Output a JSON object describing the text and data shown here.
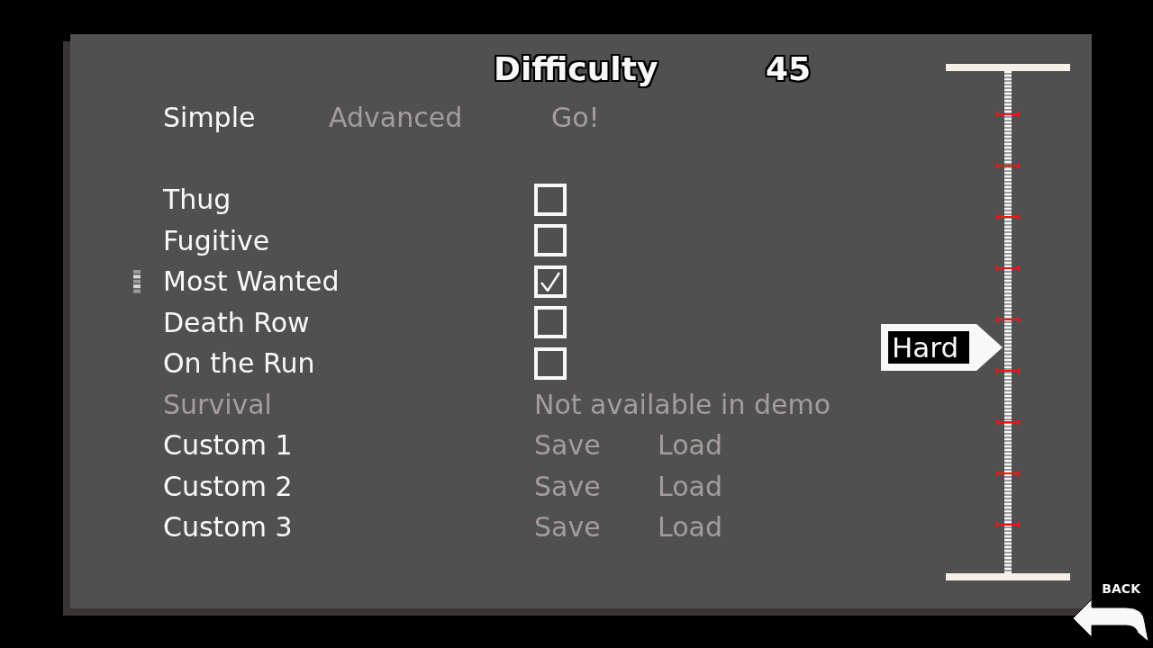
{
  "title": {
    "label": "Difficulty",
    "value": "45"
  },
  "tabs": [
    {
      "label": "Simple",
      "selected": true
    },
    {
      "label": "Advanced",
      "selected": false
    }
  ],
  "go_button": "Go!",
  "rows": [
    {
      "kind": "checkbox",
      "label": "Thug",
      "selected": false,
      "disabled": false,
      "checked": false
    },
    {
      "kind": "checkbox",
      "label": "Fugitive",
      "selected": false,
      "disabled": false,
      "checked": false
    },
    {
      "kind": "checkbox",
      "label": "Most Wanted",
      "selected": true,
      "disabled": false,
      "checked": true
    },
    {
      "kind": "checkbox",
      "label": "Death Row",
      "selected": false,
      "disabled": false,
      "checked": false
    },
    {
      "kind": "checkbox",
      "label": "On the Run",
      "selected": false,
      "disabled": false,
      "checked": false
    },
    {
      "kind": "note",
      "label": "Survival",
      "selected": false,
      "disabled": true,
      "note": "Not available in demo"
    },
    {
      "kind": "slot",
      "label": "Custom 1",
      "selected": false,
      "disabled": false,
      "actions": [
        "Save",
        "Load"
      ]
    },
    {
      "kind": "slot",
      "label": "Custom 2",
      "selected": false,
      "disabled": false,
      "actions": [
        "Save",
        "Load"
      ]
    },
    {
      "kind": "slot",
      "label": "Custom 3",
      "selected": false,
      "disabled": false,
      "actions": [
        "Save",
        "Load"
      ]
    }
  ],
  "slider": {
    "level": 0.45,
    "thumb_label": "Hard"
  },
  "back_button": "BACK"
}
